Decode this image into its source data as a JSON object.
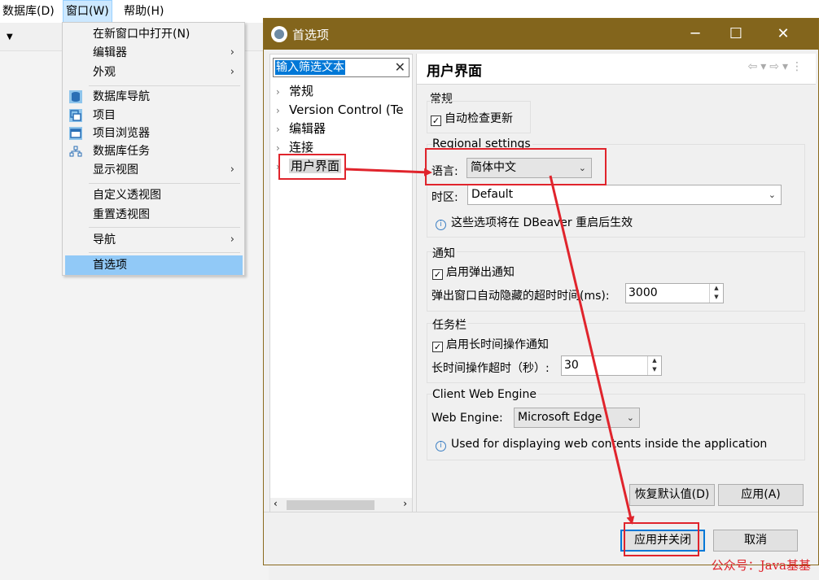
{
  "menubar": {
    "items": [
      "数据库(D)",
      "窗口(W)",
      "帮助(H)"
    ]
  },
  "window_menu": {
    "items": [
      {
        "label": "在新窗口中打开(N)",
        "submenu": false
      },
      {
        "label": "编辑器",
        "submenu": true
      },
      {
        "label": "外观",
        "submenu": true
      },
      {
        "label": "数据库导航",
        "icon": "database-navigator-icon"
      },
      {
        "label": "项目",
        "icon": "projects-icon"
      },
      {
        "label": "项目浏览器",
        "icon": "project-explorer-icon"
      },
      {
        "label": "数据库任务",
        "icon": "database-tasks-icon"
      },
      {
        "label": "显示视图",
        "submenu": true
      },
      {
        "label": "自定义透视图"
      },
      {
        "label": "重置透视图"
      },
      {
        "label": "导航",
        "submenu": true
      },
      {
        "label": "首选项",
        "highlighted": true
      }
    ]
  },
  "dialog": {
    "title": "首选项",
    "filter_text": "输入筛选文本",
    "tree": [
      "常规",
      "Version Control (Te",
      "编辑器",
      "连接",
      "用户界面"
    ],
    "selected_tree": "用户界面",
    "page_title": "用户界面",
    "general": {
      "title": "常规",
      "auto_update": "自动检查更新",
      "auto_update_checked": true
    },
    "regional": {
      "title": "Regional settings",
      "language_label": "语言:",
      "language_value": "简体中文",
      "timezone_label": "时区:",
      "timezone_value": "Default",
      "note": "这些选项将在 DBeaver 重启后生效"
    },
    "notifications": {
      "title": "通知",
      "enable_popup": "启用弹出通知",
      "enable_popup_checked": true,
      "timeout_label": "弹出窗口自动隐藏的超时时间(ms):",
      "timeout_value": "3000"
    },
    "taskbar": {
      "title": "任务栏",
      "enable_long_op": "启用长时间操作通知",
      "enable_long_op_checked": true,
      "long_op_label": "长时间操作超时（秒）:",
      "long_op_value": "30"
    },
    "web_engine": {
      "title": "Client Web Engine",
      "label": "Web Engine:",
      "value": "Microsoft Edge",
      "note": "Used for displaying web contents inside the application"
    },
    "restore_defaults": "恢复默认值(D)",
    "apply": "应用(A)",
    "apply_close": "应用并关闭",
    "cancel": "取消"
  },
  "watermark": "公众号：Java基基",
  "colors": {
    "titlebar": "#83651c",
    "annotation": "#e0242c",
    "selection": "#0078d7"
  }
}
